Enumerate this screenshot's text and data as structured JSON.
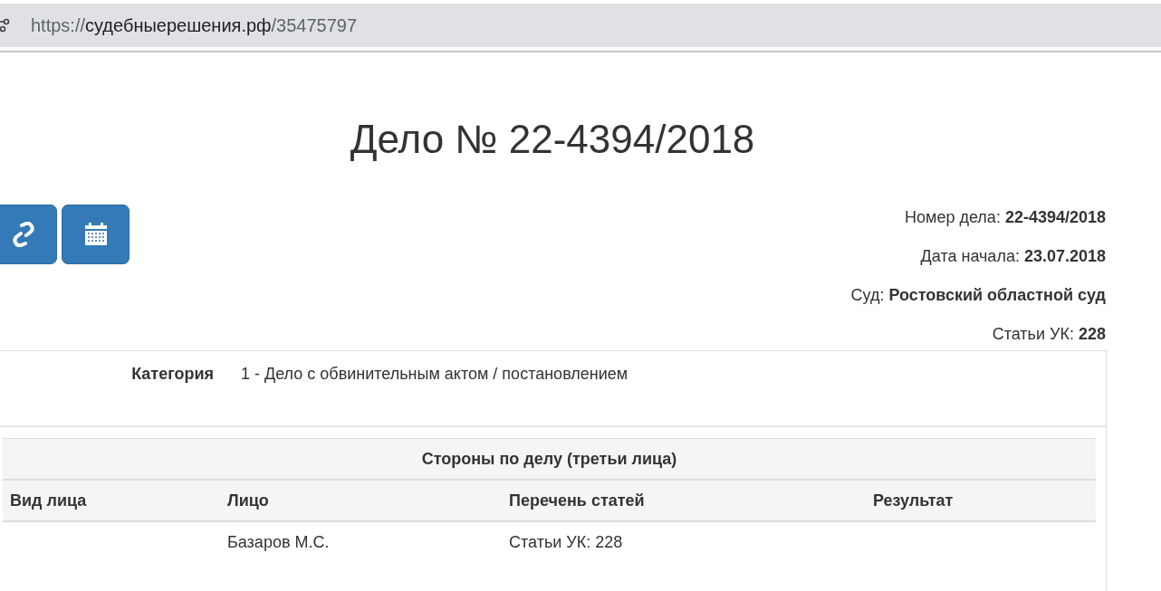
{
  "address_bar": {
    "scheme": "https://",
    "host": "судебныерешения.рф",
    "path": "/35475797"
  },
  "title": "Дело № 22-4394/2018",
  "toolbar": [
    {
      "kind": "link"
    },
    {
      "kind": "calendar"
    }
  ],
  "info": [
    {
      "label": "Номер дела:",
      "value": "22-4394/2018"
    },
    {
      "label": "Дата начала:",
      "value": "23.07.2018"
    },
    {
      "label": "Суд:",
      "value": "Ростовский областной суд"
    },
    {
      "label": "Статьи УК:",
      "value": "228"
    }
  ],
  "category": {
    "label": "Категория",
    "value": "1 - Дело с обвинительным актом / постановлением"
  },
  "parties_table": {
    "caption": "Стороны по делу (третьи лица)",
    "columns": [
      "Вид лица",
      "Лицо",
      "Перечень статей",
      "Результат"
    ],
    "rows": [
      [
        "",
        "Базаров М.С.",
        "Статьи УК: 228",
        ""
      ]
    ]
  }
}
